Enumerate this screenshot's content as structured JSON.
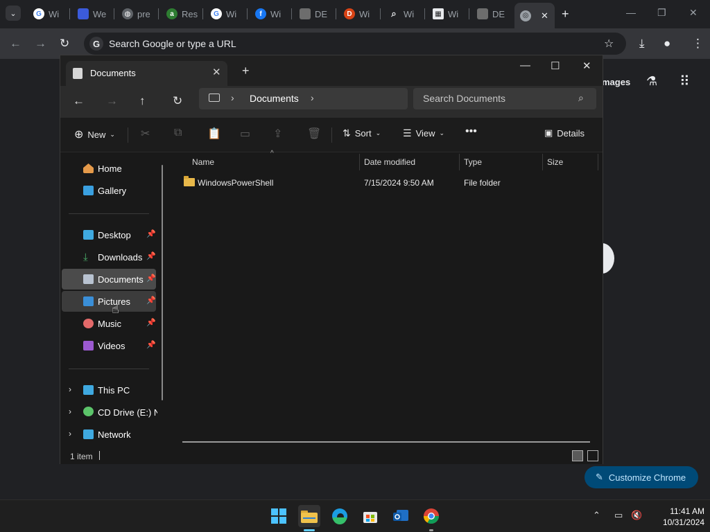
{
  "chrome": {
    "tabs": [
      {
        "label": "Wi",
        "icon": "google-icon",
        "color": "#4285f4"
      },
      {
        "label": "We",
        "icon": "site-icon",
        "color": "#3b5bdb"
      },
      {
        "label": "pre",
        "icon": "globe-icon",
        "color": "#9aa0a6"
      },
      {
        "label": "Res",
        "icon": "site-icon",
        "color": "#2e7d32"
      },
      {
        "label": "Wi",
        "icon": "google-icon",
        "color": "#4285f4"
      },
      {
        "label": "Wi",
        "icon": "facebook-icon",
        "color": "#1877f2"
      },
      {
        "label": "DE",
        "icon": "site-icon",
        "color": "#6d6d6d"
      },
      {
        "label": "Wi",
        "icon": "site-icon",
        "color": "#d84315"
      },
      {
        "label": "Wi",
        "icon": "search-icon",
        "color": "#9aa0a6"
      },
      {
        "label": "Wi",
        "icon": "site-icon",
        "color": "#9aa0a6"
      },
      {
        "label": "DE",
        "icon": "site-icon",
        "color": "#6d6d6d"
      },
      {
        "label": "",
        "icon": "chrome-icon",
        "color": "#9aa0a6"
      }
    ],
    "omnibox_placeholder": "Search Google or type a URL",
    "ntp_images_label": "mages",
    "customize_label": "Customize Chrome"
  },
  "explorer": {
    "tab_title": "Documents",
    "address": {
      "location": "Documents"
    },
    "search_placeholder": "Search Documents",
    "commands": {
      "new": "New",
      "sort": "Sort",
      "view": "View",
      "details": "Details"
    },
    "nav": {
      "home": "Home",
      "gallery": "Gallery",
      "desktop": "Desktop",
      "downloads": "Downloads",
      "documents": "Documents",
      "pictures": "Pictures",
      "music": "Music",
      "videos": "Videos",
      "this_pc": "This PC",
      "cd_drive": "CD Drive (E:) NC",
      "network": "Network"
    },
    "columns": {
      "name": "Name",
      "date": "Date modified",
      "type": "Type",
      "size": "Size"
    },
    "files": [
      {
        "name": "WindowsPowerShell",
        "date": "7/15/2024 9:50 AM",
        "type": "File folder",
        "size": ""
      }
    ],
    "status": "1 item"
  },
  "taskbar": {
    "time": "11:41 AM",
    "date": "10/31/2024"
  }
}
